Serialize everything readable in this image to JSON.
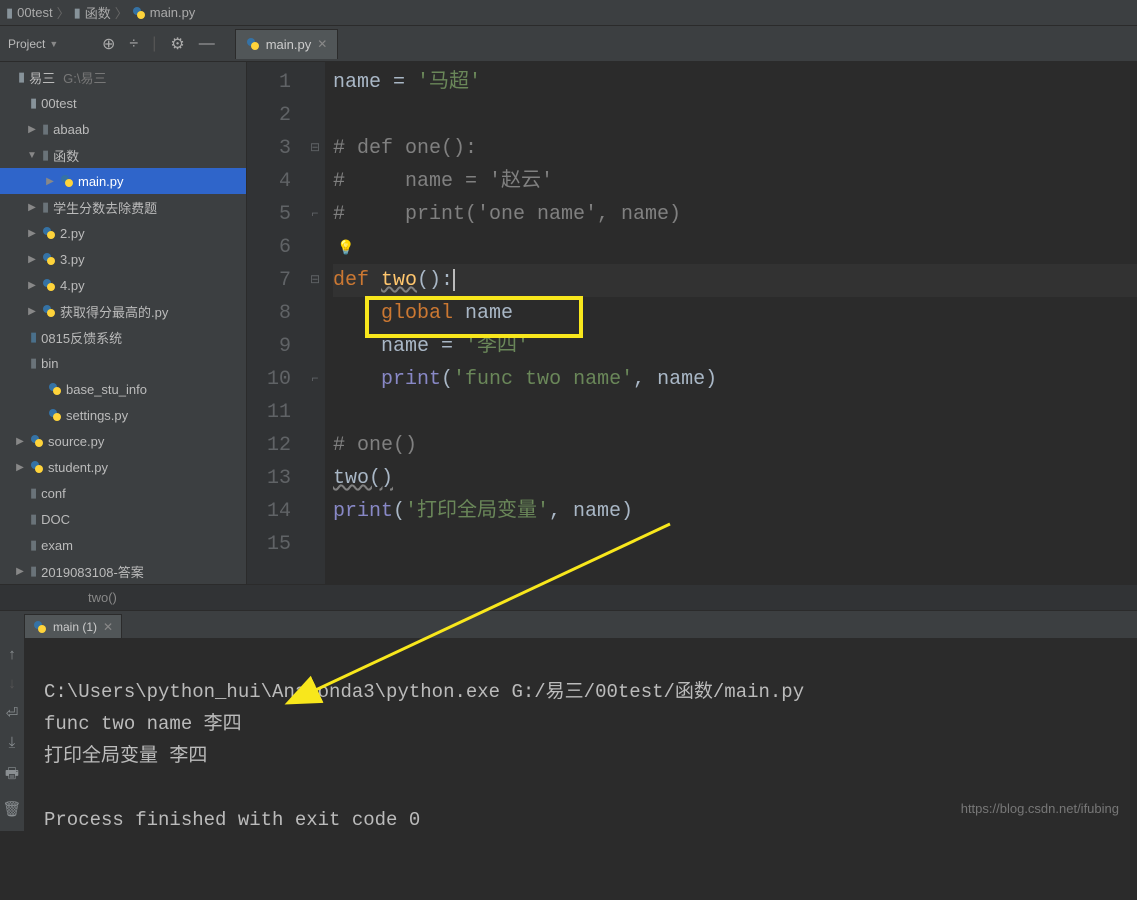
{
  "breadcrumb": {
    "p1": "00test",
    "p2": "函数",
    "p3": "main.py"
  },
  "project_label": "Project",
  "editor_tab": "main.py",
  "tree": {
    "root": "易三",
    "root_path": "G:\\易三",
    "n00test": "00test",
    "abaab": "abaab",
    "hanshu": "函数",
    "mainpy": "main.py",
    "xuesheng": "学生分数去除费题",
    "py2": "2.py",
    "py3": "3.py",
    "py4": "4.py",
    "huoqu": "获取得分最高的.py",
    "fk": "0815反馈系统",
    "bin": "bin",
    "basestu": "base_stu_info",
    "settings": "settings.py",
    "source": "source.py",
    "student": "student.py",
    "conf": "conf",
    "doc": "DOC",
    "exam": "exam",
    "answer": "2019083108-答案"
  },
  "gutter": [
    "1",
    "2",
    "3",
    "4",
    "5",
    "6",
    "7",
    "8",
    "9",
    "10",
    "11",
    "12",
    "13",
    "14",
    "15"
  ],
  "code": {
    "l1a": "name = ",
    "l1b": "'马超'",
    "l3": "# def one():",
    "l4": "#     name = '赵云'",
    "l5": "#     print('one name', name)",
    "l7a": "def ",
    "l7b": "two",
    "l7c": "():",
    "l8a": "global",
    "l8b": " name",
    "l9a": "name = ",
    "l9b": "'李四'",
    "l10a": "print",
    "l10b": "(",
    "l10c": "'func two name'",
    "l10d": ", name)",
    "l12": "# one()",
    "l13": "two()",
    "l14a": "print",
    "l14b": "(",
    "l14c": "'打印全局变量'",
    "l14d": ", name)"
  },
  "crumb_fn": "two()",
  "term_tab": "main (1)",
  "terminal": {
    "l1": "C:\\Users\\python_hui\\Anaconda3\\python.exe G:/易三/00test/函数/main.py",
    "l2": "func two name 李四",
    "l3": "打印全局变量 李四",
    "l4": "",
    "l5": "Process finished with exit code 0"
  },
  "watermark": "https://blog.csdn.net/ifubing"
}
